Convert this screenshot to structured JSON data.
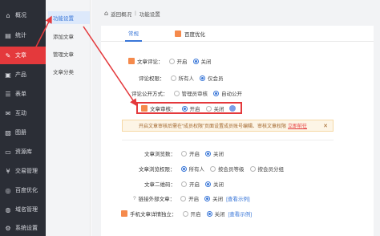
{
  "sidebar": {
    "items": [
      {
        "label": "概况",
        "icon": "home-icon",
        "glyph": "⌂"
      },
      {
        "label": "统计",
        "icon": "chart-icon",
        "glyph": "▤"
      },
      {
        "label": "文章",
        "icon": "article-icon",
        "glyph": "✎"
      },
      {
        "label": "产品",
        "icon": "product-icon",
        "glyph": "▣"
      },
      {
        "label": "表单",
        "icon": "form-icon",
        "glyph": "☰"
      },
      {
        "label": "互动",
        "icon": "chat-icon",
        "glyph": "✉"
      },
      {
        "label": "图册",
        "icon": "album-icon",
        "glyph": "▧"
      },
      {
        "label": "资源库",
        "icon": "folder-icon",
        "glyph": "▭"
      },
      {
        "label": "交易管理",
        "icon": "trade-icon",
        "glyph": "¥"
      },
      {
        "label": "百度优化",
        "icon": "seo-icon",
        "glyph": "◎"
      },
      {
        "label": "域名管理",
        "icon": "globe-icon",
        "glyph": "◍"
      },
      {
        "label": "系统设置",
        "icon": "gear-icon",
        "glyph": "⚙"
      }
    ],
    "active_index": 2
  },
  "submenu": {
    "items": [
      "功能设置",
      "添加文章",
      "管理文章",
      "文章分类"
    ],
    "active_index": 0
  },
  "breadcrumb": {
    "back": "返回概况",
    "separator": "|",
    "current": "功能设置"
  },
  "tabs": [
    "常规",
    "百度优化"
  ],
  "form": {
    "article_comment": {
      "label": "文章评论：",
      "options": [
        "开启",
        "关闭"
      ],
      "selected": 1
    },
    "comment_permission": {
      "label": "评论权限：",
      "options": [
        "所有人",
        "仅会员"
      ],
      "selected": 1
    },
    "comment_publish": {
      "label": "评论公开方式：",
      "options": [
        "管理员审核",
        "自动公开"
      ],
      "selected": 1
    },
    "article_review": {
      "label": "文章审核：",
      "options": [
        "开启",
        "关闭"
      ],
      "selected": 0
    },
    "notice": {
      "text": "开启文章审核后需在“成员权限”页面设置成员账号编辑、审核文章权限",
      "link": "立即前往",
      "close": "✕"
    },
    "browse_count": {
      "label": "文章浏览数：",
      "options": [
        "开启",
        "关闭"
      ],
      "selected": 1
    },
    "browse_permission": {
      "label": "文章浏览权限：",
      "options": [
        "所有人",
        "按会员等级",
        "按会员分组"
      ],
      "selected": 0
    },
    "qr_code": {
      "label": "文章二维码：",
      "options": [
        "开启",
        "关闭"
      ],
      "selected": 1
    },
    "external_link": {
      "label": "链接外部文章：",
      "options": [
        "开启",
        "关闭"
      ],
      "selected": 1,
      "link": "[查看示例]"
    },
    "mobile_detail": {
      "label": "手机文章详情独立：",
      "options": [
        "开启",
        "关闭"
      ],
      "selected": 1,
      "link": "[查看示例]"
    }
  },
  "colors": {
    "accent": "#3a77d8",
    "danger": "#e4393c",
    "sidebar": "#2b2e36"
  }
}
